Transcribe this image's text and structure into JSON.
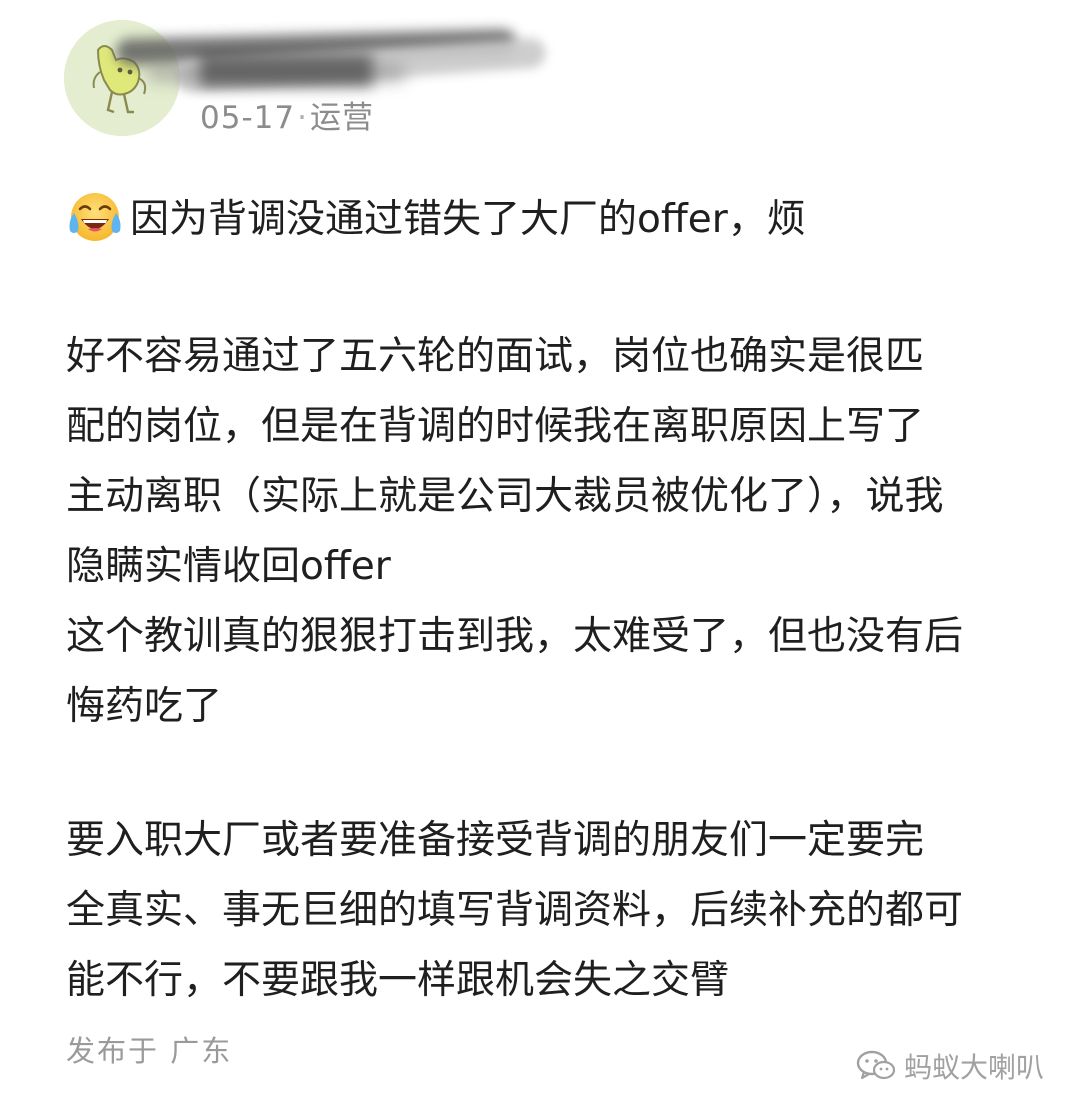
{
  "header": {
    "avatar_icon": "cartoon-character-avatar",
    "username_redacted": "████████",
    "date": "05-17",
    "separator": "·",
    "category": "运营"
  },
  "post": {
    "title_emoji": "laughing-crying-emoji",
    "title": "因为背调没通过错失了大厂的offer，烦",
    "paragraph1": [
      "好不容易通过了五六轮的面试，岗位也确实是很匹",
      "配的岗位，但是在背调的时候我在离职原因上写了",
      "主动离职（实际上就是公司大裁员被优化了），说我",
      "隐瞒实情收回offer",
      "这个教训真的狠狠打击到我，太难受了，但也没有后",
      "悔药吃了"
    ],
    "paragraph2": [
      "要入职大厂或者要准备接受背调的朋友们一定要完",
      "全真实、事无巨细的填写背调资料，后续补充的都可",
      "能不行，不要跟我一样跟机会失之交臂"
    ],
    "location": "发布于 广东"
  },
  "watermark": {
    "icon": "wechat-official-account-icon",
    "text": "蚂蚁大喇叭"
  }
}
